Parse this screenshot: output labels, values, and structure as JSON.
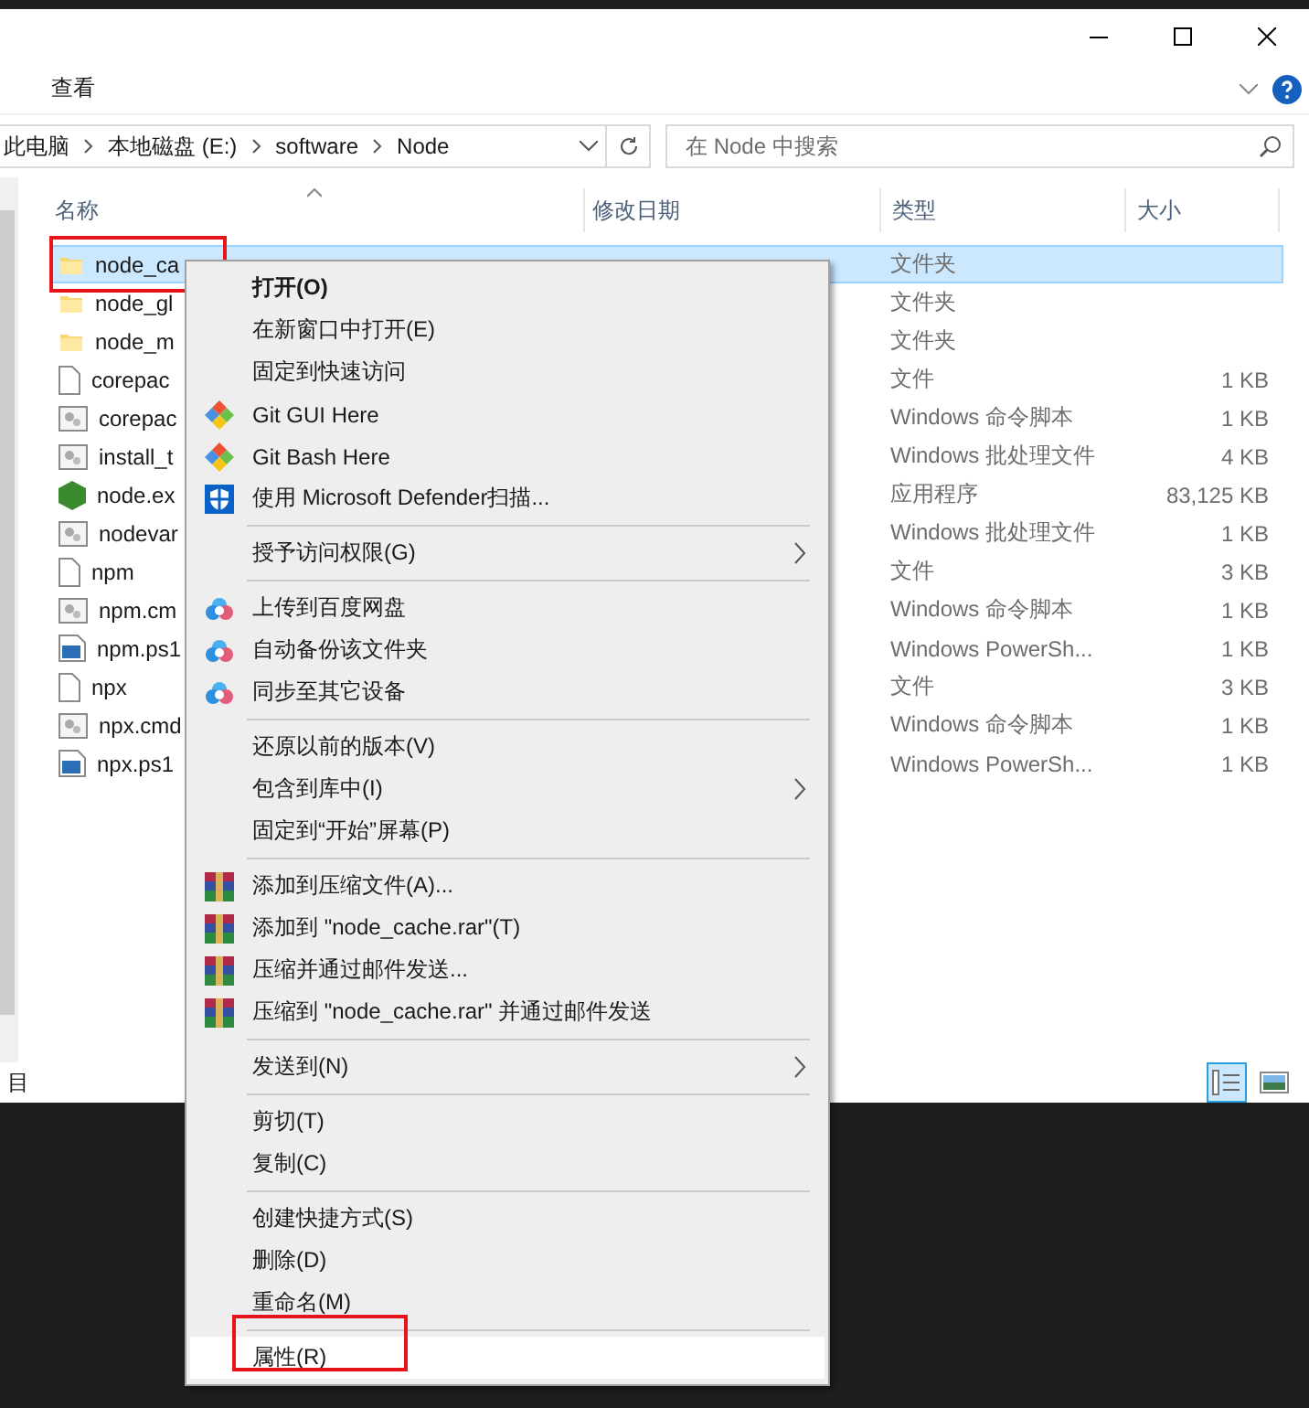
{
  "ribbon": {
    "tabs": [
      {
        "label": "查看"
      }
    ]
  },
  "address": {
    "crumbs": [
      "此电脑",
      "本地磁盘 (E:)",
      "software",
      "Node"
    ],
    "search_placeholder": "在 Node 中搜索"
  },
  "columns": [
    {
      "label": "名称",
      "sorted": true
    },
    {
      "label": "修改日期",
      "sorted": false
    },
    {
      "label": "类型",
      "sorted": false
    },
    {
      "label": "大小",
      "sorted": false
    }
  ],
  "files": [
    {
      "name": "node_ca",
      "type": "文件夹",
      "kind": "folder",
      "selected": true,
      "annotated": true
    },
    {
      "name": "node_gl",
      "type": "文件夹",
      "kind": "folder",
      "selected": false,
      "annotated": false
    },
    {
      "name": "node_m",
      "type": "文件夹",
      "kind": "folder",
      "selected": false,
      "annotated": false
    },
    {
      "name": "corepac",
      "type": "文件",
      "size": "1 KB",
      "kind": "file",
      "selected": false,
      "annotated": false
    },
    {
      "name": "corepac",
      "type": "Windows 命令脚本",
      "size": "1 KB",
      "kind": "script",
      "selected": false,
      "annotated": false
    },
    {
      "name": "install_t",
      "type": "Windows 批处理文件",
      "size": "4 KB",
      "kind": "script",
      "selected": false,
      "annotated": false
    },
    {
      "name": "node.ex",
      "type": "应用程序",
      "size": "83,125 KB",
      "kind": "app",
      "selected": false,
      "annotated": false
    },
    {
      "name": "nodevar",
      "type": "Windows 批处理文件",
      "size": "1 KB",
      "kind": "script",
      "selected": false,
      "annotated": false
    },
    {
      "name": "npm",
      "type": "文件",
      "size": "3 KB",
      "kind": "file",
      "selected": false,
      "annotated": false
    },
    {
      "name": "npm.cm",
      "type": "Windows 命令脚本",
      "size": "1 KB",
      "kind": "script",
      "selected": false,
      "annotated": false
    },
    {
      "name": "npm.ps1",
      "type": "Windows PowerSh...",
      "size": "1 KB",
      "kind": "powershell",
      "selected": false,
      "annotated": false
    },
    {
      "name": "npx",
      "type": "文件",
      "size": "3 KB",
      "kind": "file",
      "selected": false,
      "annotated": false
    },
    {
      "name": "npx.cmd",
      "type": "Windows 命令脚本",
      "size": "1 KB",
      "kind": "script",
      "selected": false,
      "annotated": false
    },
    {
      "name": "npx.ps1",
      "type": "Windows PowerSh...",
      "size": "1 KB",
      "kind": "powershell",
      "selected": false,
      "annotated": false
    }
  ],
  "status_bar": {
    "text": "目",
    "views": [
      {
        "kind": "details",
        "selected": true
      },
      {
        "kind": "thumbnails",
        "selected": false
      }
    ]
  },
  "context_menu": [
    {
      "kind": "item",
      "label": "打开(O)",
      "bold": true,
      "submenu": false,
      "highlighted": false,
      "annotated": false
    },
    {
      "kind": "item",
      "label": "在新窗口中打开(E)",
      "bold": false,
      "submenu": false,
      "highlighted": false,
      "annotated": false
    },
    {
      "kind": "item",
      "label": "固定到快速访问",
      "bold": false,
      "submenu": false,
      "highlighted": false,
      "annotated": false
    },
    {
      "kind": "git",
      "label": "Git GUI Here",
      "bold": false,
      "submenu": false,
      "highlighted": false,
      "annotated": false
    },
    {
      "kind": "git",
      "label": "Git Bash Here",
      "bold": false,
      "submenu": false,
      "highlighted": false,
      "annotated": false
    },
    {
      "kind": "shield",
      "label": "使用 Microsoft Defender扫描...",
      "bold": false,
      "submenu": false,
      "highlighted": false,
      "annotated": false
    },
    {
      "kind": "separator"
    },
    {
      "kind": "item",
      "label": "授予访问权限(G)",
      "bold": false,
      "submenu": true,
      "highlighted": false,
      "annotated": false
    },
    {
      "kind": "separator"
    },
    {
      "kind": "cloud",
      "label": "上传到百度网盘",
      "bold": false,
      "submenu": false,
      "highlighted": false,
      "annotated": false
    },
    {
      "kind": "cloud",
      "label": "自动备份该文件夹",
      "bold": false,
      "submenu": false,
      "highlighted": false,
      "annotated": false
    },
    {
      "kind": "cloud",
      "label": "同步至其它设备",
      "bold": false,
      "submenu": false,
      "highlighted": false,
      "annotated": false
    },
    {
      "kind": "separator"
    },
    {
      "kind": "item",
      "label": "还原以前的版本(V)",
      "bold": false,
      "submenu": false,
      "highlighted": false,
      "annotated": false
    },
    {
      "kind": "item",
      "label": "包含到库中(I)",
      "bold": false,
      "submenu": true,
      "highlighted": false,
      "annotated": false
    },
    {
      "kind": "item",
      "label": "固定到“开始”屏幕(P)",
      "bold": false,
      "submenu": false,
      "highlighted": false,
      "annotated": false
    },
    {
      "kind": "separator"
    },
    {
      "kind": "archive",
      "label": "添加到压缩文件(A)...",
      "bold": false,
      "submenu": false,
      "highlighted": false,
      "annotated": false
    },
    {
      "kind": "archive",
      "label": "添加到 \"node_cache.rar\"(T)",
      "bold": false,
      "submenu": false,
      "highlighted": false,
      "annotated": false
    },
    {
      "kind": "archive",
      "label": "压缩并通过邮件发送...",
      "bold": false,
      "submenu": false,
      "highlighted": false,
      "annotated": false
    },
    {
      "kind": "archive",
      "label": "压缩到 \"node_cache.rar\" 并通过邮件发送",
      "bold": false,
      "submenu": false,
      "highlighted": false,
      "annotated": false
    },
    {
      "kind": "separator"
    },
    {
      "kind": "item",
      "label": "发送到(N)",
      "bold": false,
      "submenu": true,
      "highlighted": false,
      "annotated": false
    },
    {
      "kind": "separator"
    },
    {
      "kind": "item",
      "label": "剪切(T)",
      "bold": false,
      "submenu": false,
      "highlighted": false,
      "annotated": false
    },
    {
      "kind": "item",
      "label": "复制(C)",
      "bold": false,
      "submenu": false,
      "highlighted": false,
      "annotated": false
    },
    {
      "kind": "separator"
    },
    {
      "kind": "item",
      "label": "创建快捷方式(S)",
      "bold": false,
      "submenu": false,
      "highlighted": false,
      "annotated": false
    },
    {
      "kind": "item",
      "label": "删除(D)",
      "bold": false,
      "submenu": false,
      "highlighted": false,
      "annotated": false
    },
    {
      "kind": "item",
      "label": "重命名(M)",
      "bold": false,
      "submenu": false,
      "highlighted": false,
      "annotated": false
    },
    {
      "kind": "separator"
    },
    {
      "kind": "item",
      "label": "属性(R)",
      "bold": false,
      "submenu": false,
      "highlighted": true,
      "annotated": true
    }
  ]
}
